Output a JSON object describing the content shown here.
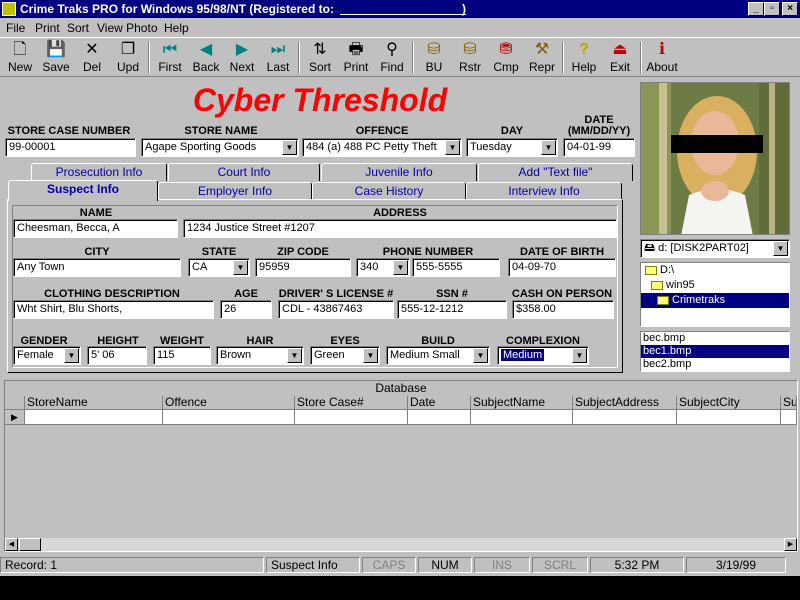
{
  "window": {
    "title": "Crime Traks PRO for Windows 95/98/NT  (Registered to:",
    "title_close_paren": ")"
  },
  "menu": [
    "File",
    "Print",
    "Sort",
    "View Photo",
    "Help"
  ],
  "toolbar": {
    "new": "New",
    "save": "Save",
    "del": "Del",
    "upd": "Upd",
    "first": "First",
    "back": "Back",
    "next": "Next",
    "last": "Last",
    "sort": "Sort",
    "print": "Print",
    "find": "Find",
    "bu": "BU",
    "rstr": "Rstr",
    "cmp": "Cmp",
    "repr": "Repr",
    "help": "Help",
    "exit": "Exit",
    "about": "About"
  },
  "banner": "Cyber Threshold",
  "header_fields": {
    "store_case_number": {
      "label": "STORE CASE NUMBER",
      "value": "99-00001"
    },
    "store_name": {
      "label": "STORE NAME",
      "value": "Agape Sporting Goods"
    },
    "offence": {
      "label": "OFFENCE",
      "value": "484 (a) 488 PC  Petty Theft"
    },
    "day": {
      "label": "DAY",
      "value": "Tuesday"
    },
    "date": {
      "label": "DATE",
      "sublabel": "(MM/DD/YY)",
      "value": "04-01-99"
    }
  },
  "tabs_back": [
    "Prosecution Info",
    "Court Info",
    "Juvenile Info",
    "Add \"Text file\""
  ],
  "tabs_front": [
    "Suspect Info",
    "Employer Info",
    "Case History",
    "Interview Info"
  ],
  "suspect": {
    "name": {
      "label": "NAME",
      "value": "Cheesman, Becca, A"
    },
    "address": {
      "label": "ADDRESS",
      "value": "1234 Justice Street  #1207"
    },
    "city": {
      "label": "CITY",
      "value": "Any Town"
    },
    "state": {
      "label": "STATE",
      "value": "CA"
    },
    "zip": {
      "label": "ZIP CODE",
      "value": "95959"
    },
    "phone": {
      "label": "PHONE NUMBER",
      "area": "340",
      "value": "555-5555"
    },
    "dob": {
      "label": "DATE OF BIRTH",
      "value": "04-09-70"
    },
    "clothing": {
      "label": "CLOTHING DESCRIPTION",
      "value": "Wht Shirt, Blu Shorts,"
    },
    "age": {
      "label": "AGE",
      "value": "26"
    },
    "license": {
      "label": "DRIVER' S LICENSE #",
      "value": "CDL - 43867463"
    },
    "ssn": {
      "label": "SSN #",
      "value": "555-12-1212"
    },
    "cash": {
      "label": "CASH ON PERSON",
      "value": "$358.00"
    },
    "gender": {
      "label": "GENDER",
      "value": "Female"
    },
    "height": {
      "label": "HEIGHT",
      "value": "5' 06"
    },
    "weight": {
      "label": "WEIGHT",
      "value": "115"
    },
    "hair": {
      "label": "HAIR",
      "value": "Brown"
    },
    "eyes": {
      "label": "EYES",
      "value": "Green"
    },
    "build": {
      "label": "BUILD",
      "value": "Medium Small"
    },
    "complexion": {
      "label": "COMPLEXION",
      "value": "Medium"
    }
  },
  "drive": "d: [DISK2PART02]",
  "dirs": [
    "D:\\",
    "win95",
    "Crimetraks"
  ],
  "files": [
    "bec.bmp",
    "bec1.bmp",
    "bec2.bmp"
  ],
  "grid": {
    "caption": "Database",
    "columns": [
      "StoreName",
      "Offence",
      "Store Case#",
      "Date",
      "SubjectName",
      "SubjectAddress",
      "SubjectCity",
      "Su"
    ]
  },
  "status": {
    "record": "Record: 1",
    "tab": "Suspect Info",
    "caps": "CAPS",
    "num": "NUM",
    "ins": "INS",
    "scrl": "SCRL",
    "time": "5:32 PM",
    "date": "3/19/99"
  },
  "colors": {
    "title_bar": "#000080",
    "banner": "#ff0000",
    "tab_text": "#0000aa",
    "selection": "#000080"
  }
}
